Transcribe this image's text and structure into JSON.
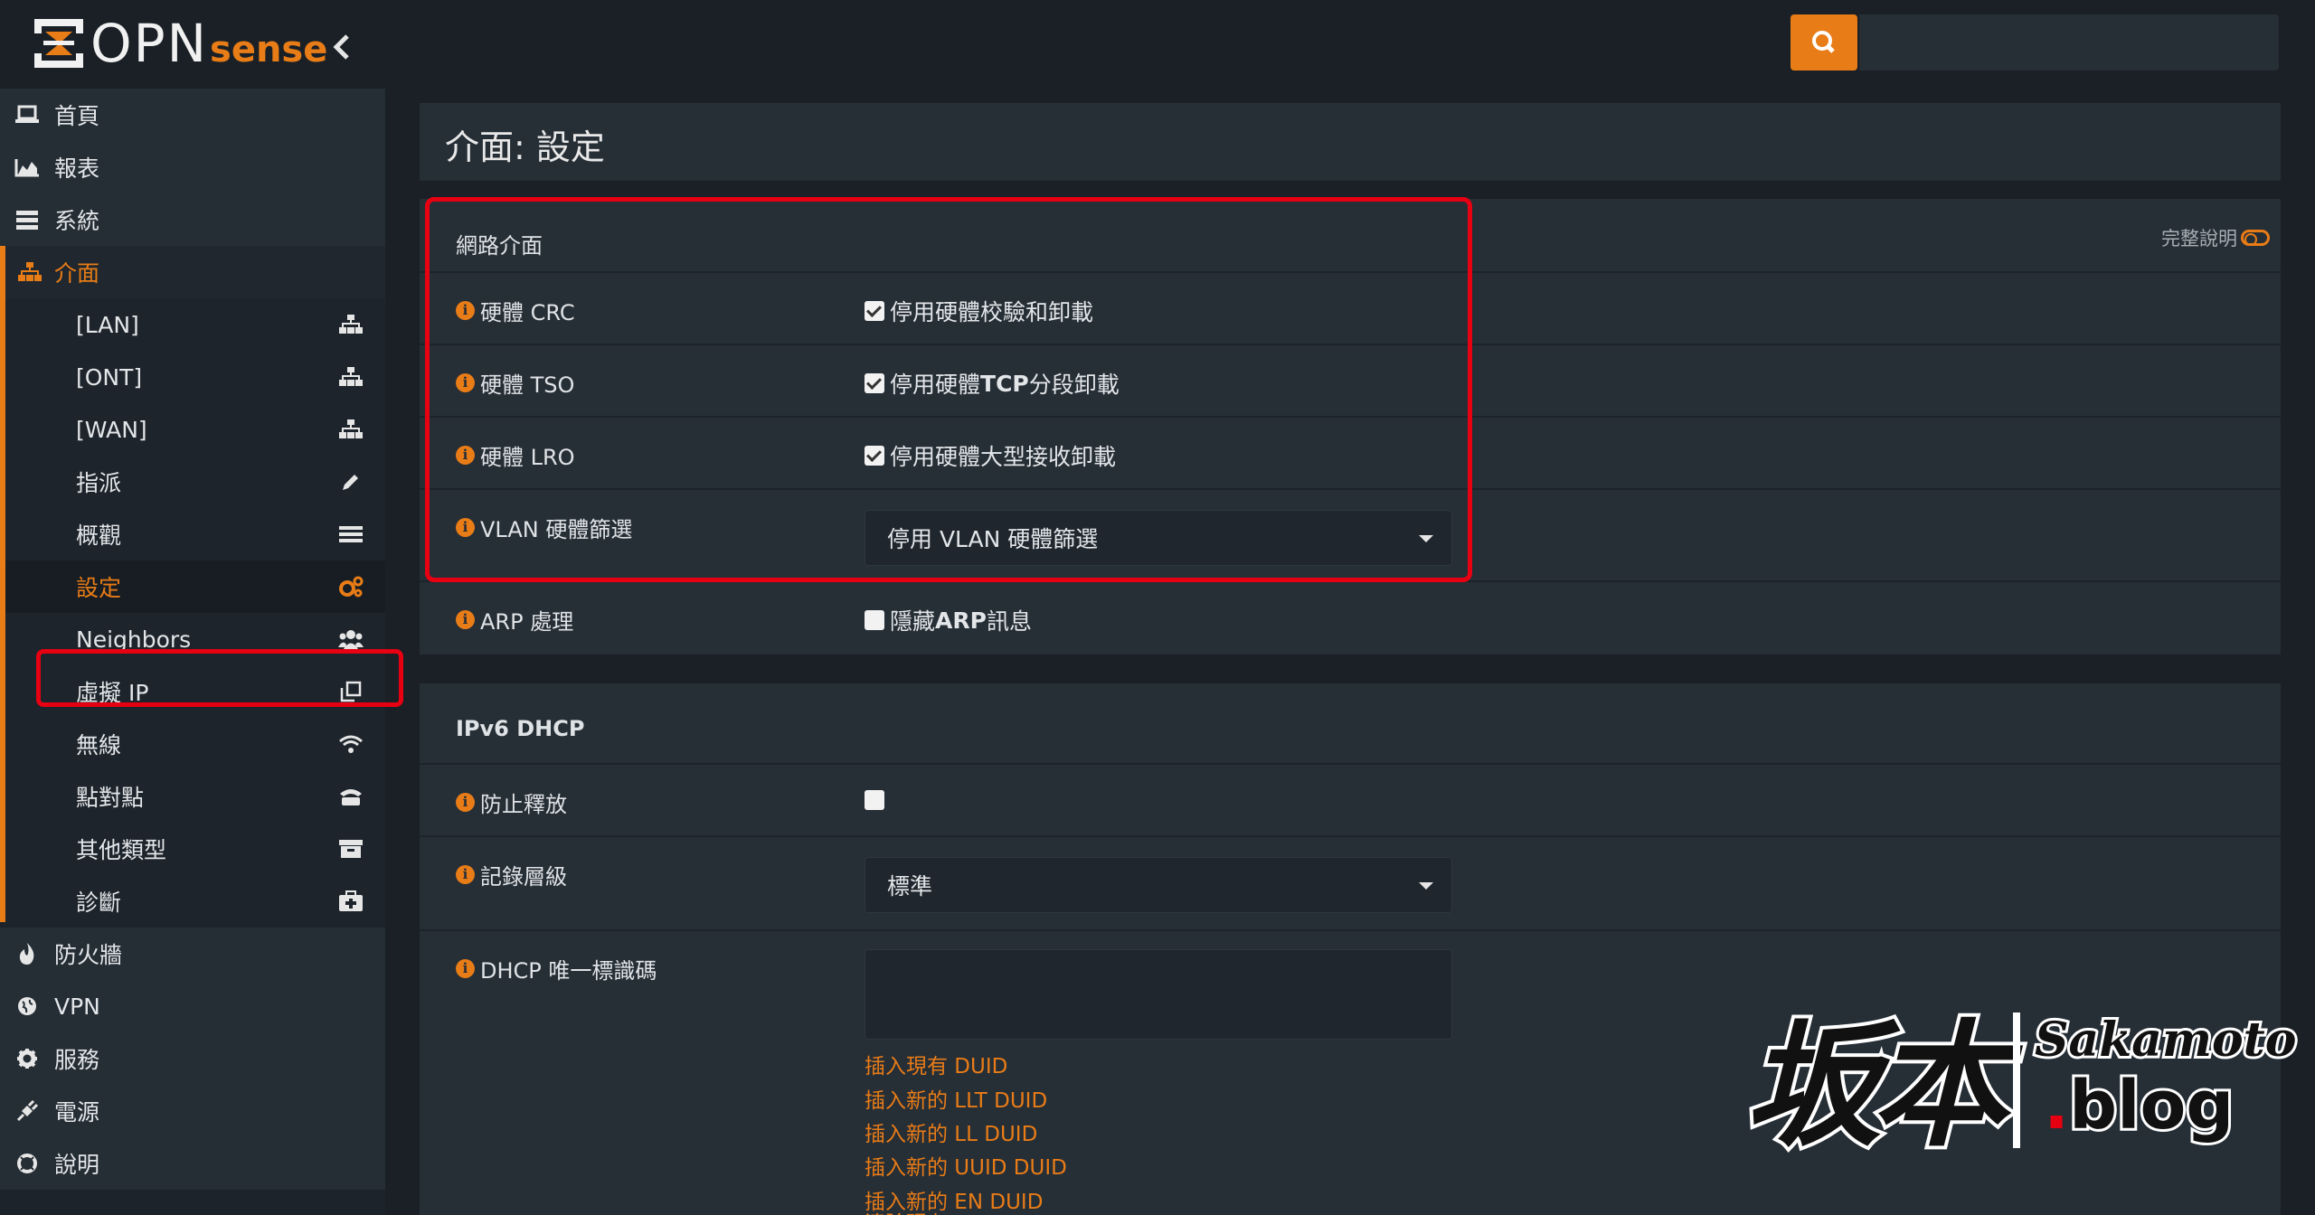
{
  "app": {
    "logo_text": "OPN",
    "logo_sense": "sense"
  },
  "search": {
    "placeholder": ""
  },
  "sidebar": {
    "items": [
      {
        "label": "首頁",
        "icon": "laptop-icon"
      },
      {
        "label": "報表",
        "icon": "area-chart-icon"
      },
      {
        "label": "系統",
        "icon": "server-icon"
      },
      {
        "label": "介面",
        "icon": "sitemap-icon"
      }
    ],
    "submenu": [
      {
        "label": "[LAN]",
        "icon": "sitemap-icon"
      },
      {
        "label": "[ONT]",
        "icon": "sitemap-icon"
      },
      {
        "label": "[WAN]",
        "icon": "sitemap-icon"
      },
      {
        "label": "指派",
        "icon": "pencil-icon"
      },
      {
        "label": "概觀",
        "icon": "list-icon"
      },
      {
        "label": "設定",
        "icon": "cogs-icon"
      },
      {
        "label": "Neighbors",
        "icon": "users-icon"
      },
      {
        "label": "虛擬 IP",
        "icon": "clone-icon"
      },
      {
        "label": "無線",
        "icon": "wifi-icon"
      },
      {
        "label": "點對點",
        "icon": "phone-icon"
      },
      {
        "label": "其他類型",
        "icon": "archive-icon"
      },
      {
        "label": "診斷",
        "icon": "medkit-icon"
      }
    ],
    "bottom": [
      {
        "label": "防火牆",
        "icon": "fire-icon"
      },
      {
        "label": "VPN",
        "icon": "globe-icon"
      },
      {
        "label": "服務",
        "icon": "cog-icon"
      },
      {
        "label": "電源",
        "icon": "plug-icon"
      },
      {
        "label": "說明",
        "icon": "life-ring-icon"
      }
    ]
  },
  "page": {
    "title": "介面: 設定"
  },
  "network": {
    "heading": "網路介面",
    "help_toggle": "完整說明",
    "crc_label": "硬體 CRC",
    "crc_option": "停用硬體校驗和卸載",
    "tso_label": "硬體 TSO",
    "tso_option_a": "停用硬體 ",
    "tso_option_b": "TCP",
    "tso_option_c": " 分段卸載",
    "lro_label": "硬體 LRO",
    "lro_option": "停用硬體大型接收卸載",
    "vlan_label": "VLAN 硬體篩選",
    "vlan_value": "停用 VLAN 硬體篩選",
    "arp_label": "ARP 處理",
    "arp_option_a": "隱藏 ",
    "arp_option_b": "ARP",
    "arp_option_c": " 訊息"
  },
  "ipv6": {
    "heading": "IPv6 DHCP",
    "prevent_label": "防止釋放",
    "log_label": "記錄層級",
    "log_value": "標準",
    "duid_label": "DHCP 唯一標識碼",
    "links": [
      "插入現有 DUID",
      "插入新的 LLT DUID",
      "插入新的 LL DUID",
      "插入新的 UUID DUID",
      "插入新的 EN DUID",
      "清除現有 DUID"
    ]
  },
  "watermark": {
    "kanji": "坂本",
    "brand_a": "Sakamoto",
    "brand_dot": ".",
    "brand_b": "blog"
  },
  "colors": {
    "accent": "#e87c17",
    "highlight": "#e60012",
    "panel": "#262e36",
    "background": "#1a2026"
  }
}
